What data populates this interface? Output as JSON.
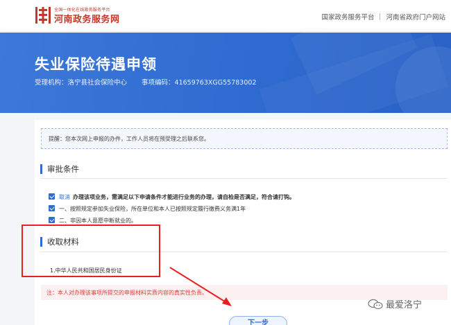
{
  "header": {
    "logo_small": "全国一体化在线政务服务平台",
    "logo_title": "河南政务服务网",
    "links": [
      "国家政务服务平台",
      "河南省政府门户网站"
    ]
  },
  "banner": {
    "title": "失业保险待遇申领",
    "agency": "受理机构：洛宁县社会保险中心",
    "code": "事项编码：41659763XGG55783002"
  },
  "notice": "提醒：您本次网上申报的办件，工作人员将在预受理之后联系您。",
  "conditions": {
    "heading": "审批条件",
    "intro_link": "取消",
    "intro_text": "办理该项业务，需满足以下申请条件才能进行业务的办理，请自检是否满足，符合请打钩。",
    "items": [
      "一、按照规定参加失业保险，所在单位和本人已按照规定履行缴费义务满1年",
      "二、非因本人意愿中断就业的。"
    ]
  },
  "materials": {
    "heading": "收取材料",
    "items": [
      "1.中华人民共和国居民身份证"
    ]
  },
  "warning": "注：本人对办理该事项所提交的申报材料实质内容的真实性负责。",
  "next_button": "下一步",
  "watermark": "最爱洛宁",
  "colors": {
    "primary": "#2f6bd1",
    "brand_red": "#c0392b",
    "annotation_red": "#e8201f",
    "warning_red": "#e23c3c"
  }
}
